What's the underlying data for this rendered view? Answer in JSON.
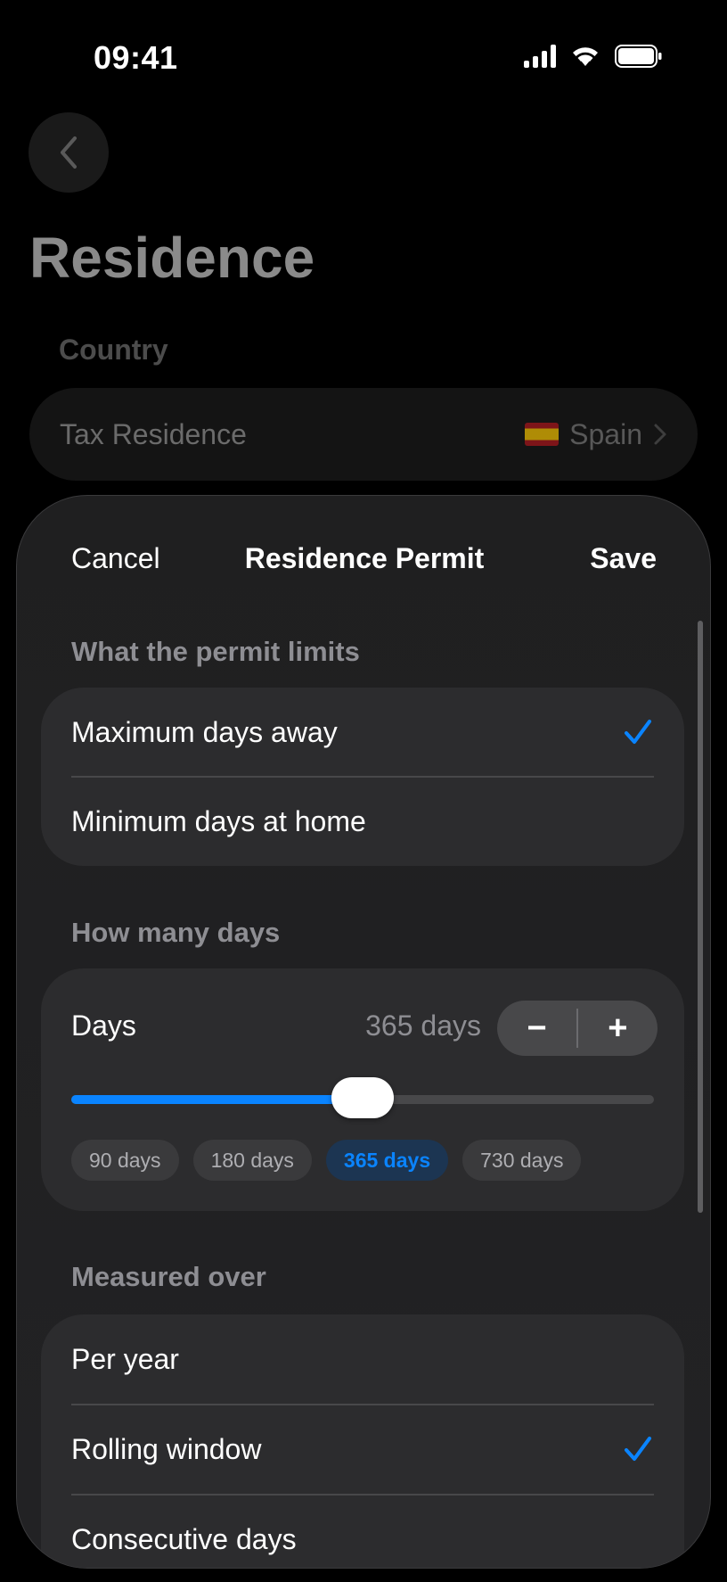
{
  "status_bar": {
    "time": "09:41"
  },
  "background_page": {
    "title": "Residence",
    "section_country": "Country",
    "tax_residence": {
      "label": "Tax Residence",
      "value": "Spain"
    }
  },
  "sheet": {
    "cancel_label": "Cancel",
    "title": "Residence Permit",
    "save_label": "Save",
    "limits": {
      "header": "What the permit limits",
      "options": [
        {
          "label": "Maximum days away",
          "selected": true
        },
        {
          "label": "Minimum days at home",
          "selected": false
        }
      ]
    },
    "how_many": {
      "header": "How many days",
      "label": "Days",
      "value_text": "365 days",
      "decrement": "−",
      "increment": "+",
      "slider_fraction": 0.5,
      "presets": [
        "90 days",
        "180 days",
        "365 days",
        "730 days"
      ],
      "active_preset": "365 days"
    },
    "measured": {
      "header": "Measured over",
      "options": [
        {
          "label": "Per year",
          "selected": false
        },
        {
          "label": "Rolling window",
          "selected": true
        },
        {
          "label": "Consecutive days",
          "selected": false
        }
      ]
    }
  },
  "colors": {
    "accent": "#0a84ff",
    "sheet_bg": "#1f1f20",
    "group_bg": "#2c2c2e"
  }
}
